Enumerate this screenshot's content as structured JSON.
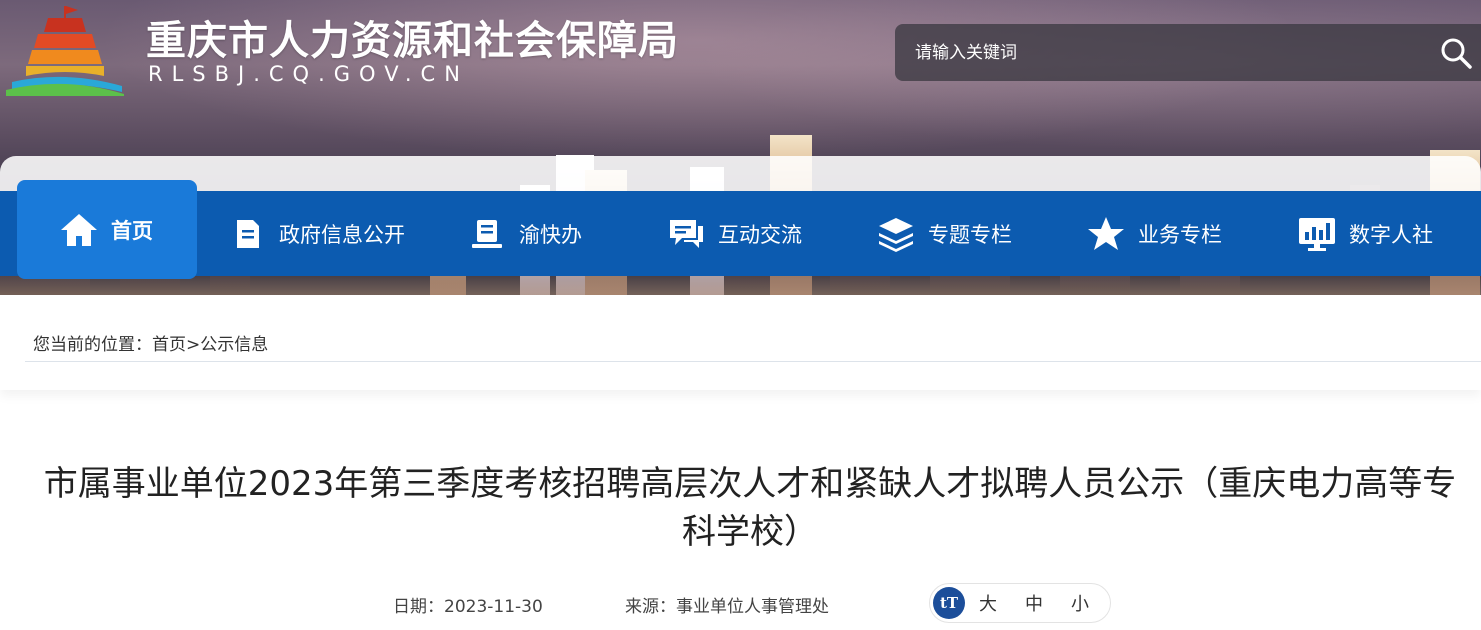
{
  "header": {
    "title": "重庆市人力资源和社会保障局",
    "domain": "RLSBJ.CQ.GOV.CN",
    "search_placeholder": "请输入关键词"
  },
  "nav": {
    "items": [
      {
        "label": "首页",
        "icon": "home-icon",
        "active": true
      },
      {
        "label": "政府信息公开",
        "icon": "document-icon"
      },
      {
        "label": "渝快办",
        "icon": "clipboard-icon"
      },
      {
        "label": "互动交流",
        "icon": "chat-icon"
      },
      {
        "label": "专题专栏",
        "icon": "layers-icon"
      },
      {
        "label": "业务专栏",
        "icon": "star-icon"
      },
      {
        "label": "数字人社",
        "icon": "monitor-chart-icon"
      }
    ]
  },
  "breadcrumb": {
    "prefix": "您当前的位置：",
    "home": "首页",
    "separator": ">",
    "current": "公示信息"
  },
  "article": {
    "title": "市属事业单位2023年第三季度考核招聘高层次人才和紧缺人才拟聘人员公示（重庆电力高等专科学校）",
    "date_label": "日期：",
    "date": "2023-11-30",
    "source_label": "来源：",
    "source": "事业单位人事管理处",
    "font_size_icon": "tT",
    "font_sizes": [
      "大",
      "中",
      "小"
    ]
  },
  "colors": {
    "nav_bg": "#0c5bb0",
    "nav_active": "#1a7ad9",
    "font_icon_bg": "#1c4e9a"
  }
}
